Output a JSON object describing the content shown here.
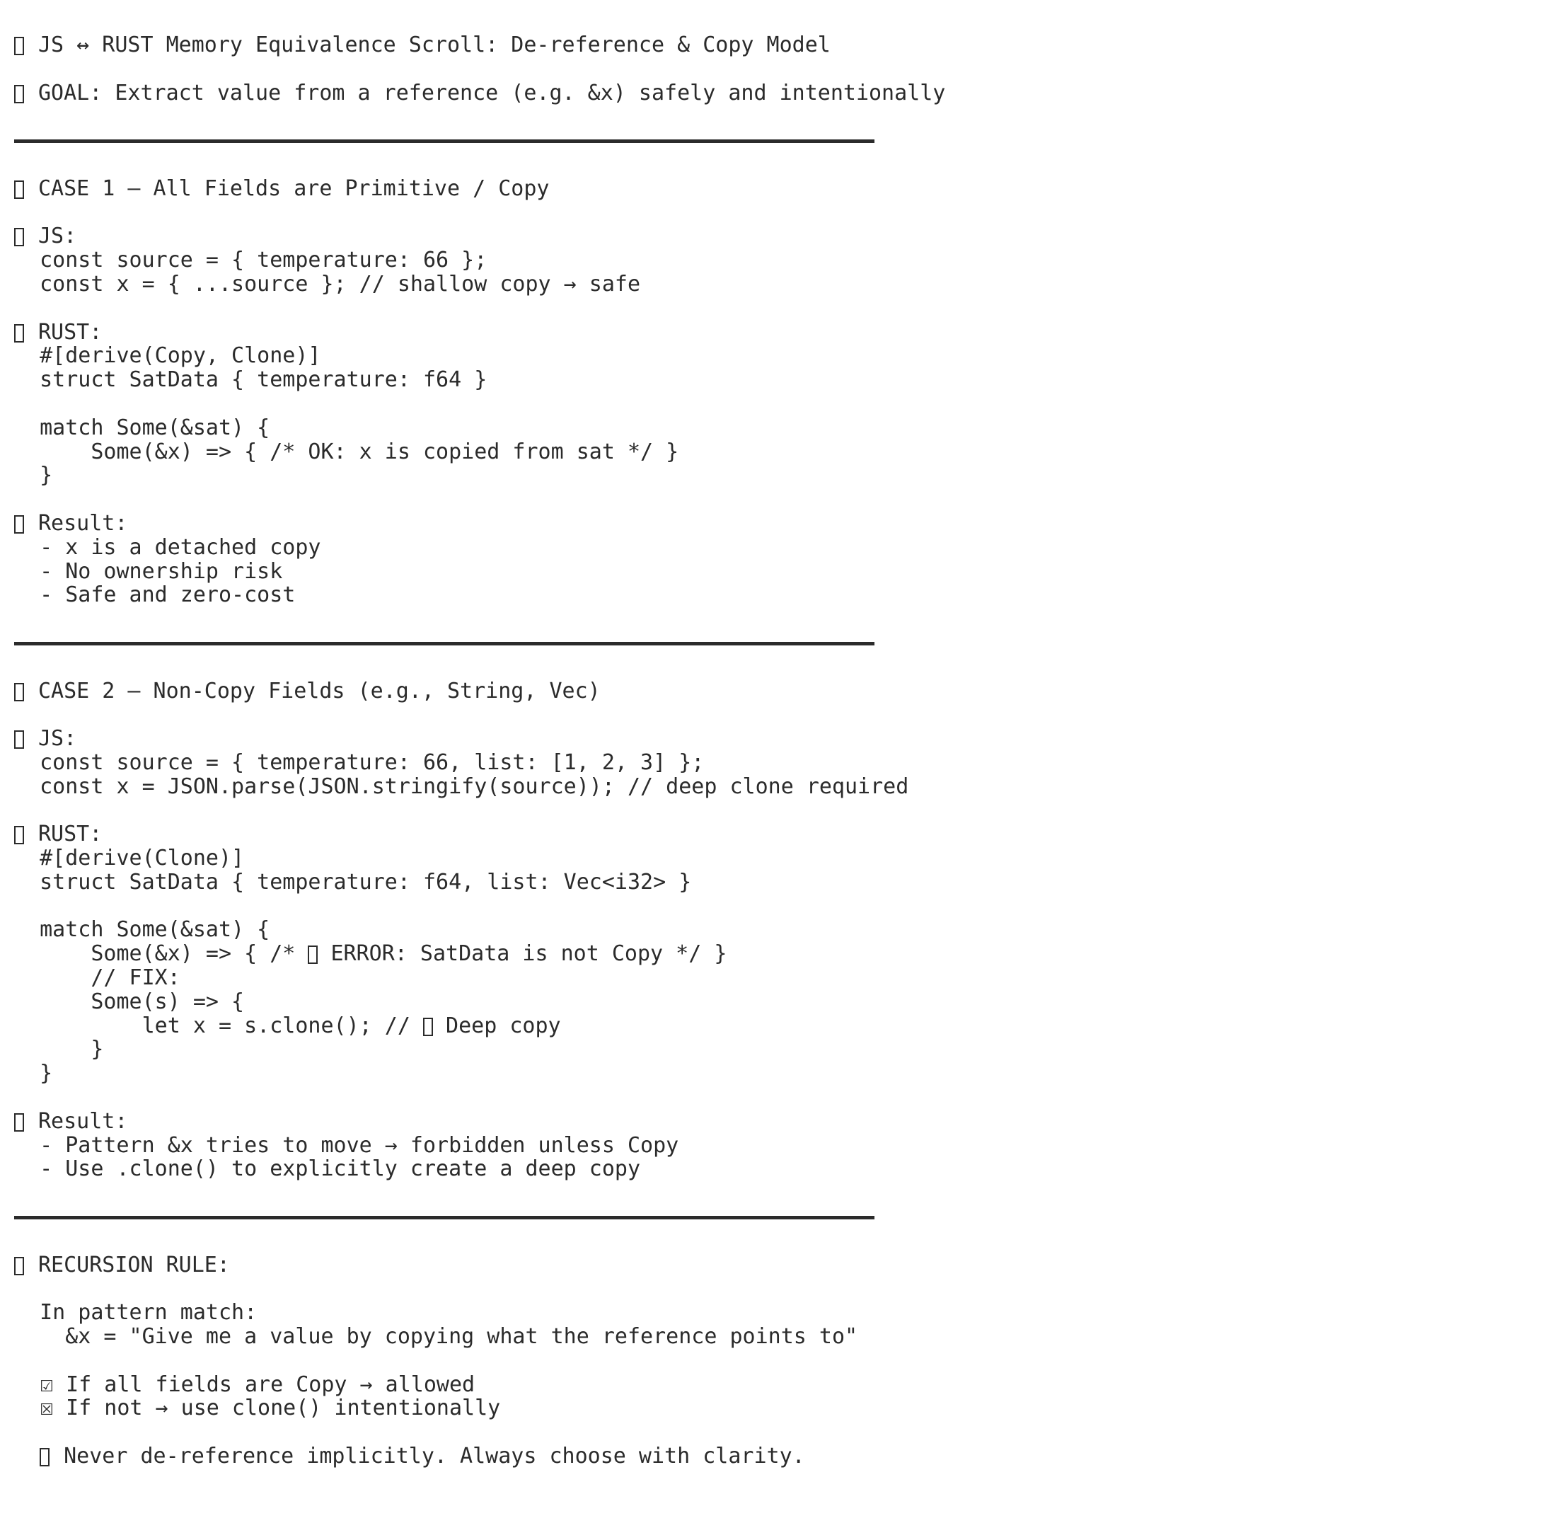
{
  "title": "JS ↔ RUST Memory Equivalence Scroll: De-reference & Copy Model",
  "goal": "GOAL: Extract value from a reference (e.g. &x) safely and intentionally",
  "case1": {
    "heading": "CASE 1 — All Fields are Primitive / Copy",
    "js_label": "JS:",
    "js_code": [
      "  const source = { temperature: 66 };",
      "  const x = { ...source }; // shallow copy → safe"
    ],
    "rust_label": "RUST:",
    "rust_code": [
      "  #[derive(Copy, Clone)]",
      "  struct SatData { temperature: f64 }",
      "",
      "  match Some(&sat) {",
      "      Some(&x) => { /* OK: x is copied from sat */ }",
      "  }"
    ],
    "result_label": "Result:",
    "result_items": [
      "  - x is a detached copy",
      "  - No ownership risk",
      "  - Safe and zero-cost"
    ]
  },
  "case2": {
    "heading": "CASE 2 — Non-Copy Fields (e.g., String, Vec)",
    "js_label": "JS:",
    "js_code": [
      "  const source = { temperature: 66, list: [1, 2, 3] };",
      "  const x = JSON.parse(JSON.stringify(source)); // deep clone required"
    ],
    "rust_label": "RUST:",
    "rust_code_a": [
      "  #[derive(Clone)]",
      "  struct SatData { temperature: f64, list: Vec<i32> }",
      "",
      "  match Some(&sat) {"
    ],
    "error_line_pre": "      Some(&x) => { /* ",
    "error_line_post": " ERROR: SatData is not Copy */ }",
    "rust_code_b": [
      "      // FIX:",
      "      Some(s) => {"
    ],
    "clone_line_pre": "          let x = s.clone(); // ",
    "clone_line_post": " Deep copy",
    "rust_code_c": [
      "      }",
      "  }"
    ],
    "result_label": "Result:",
    "result_items": [
      "  - Pattern &x tries to move → forbidden unless Copy",
      "  - Use .clone() to explicitly create a deep copy"
    ]
  },
  "recursion": {
    "heading": "RECURSION RULE:",
    "intro": "  In pattern match:",
    "meaning": "    &x = \"Give me a value by copying what the reference points to\"",
    "check_allowed_glyph": "☑",
    "check_allowed_text": "If all fields are Copy → allowed",
    "check_denied_glyph": "☒",
    "check_denied_text": "If not → use clone() intentionally",
    "closing": "Never de-reference implicitly. Always choose with clarity."
  }
}
